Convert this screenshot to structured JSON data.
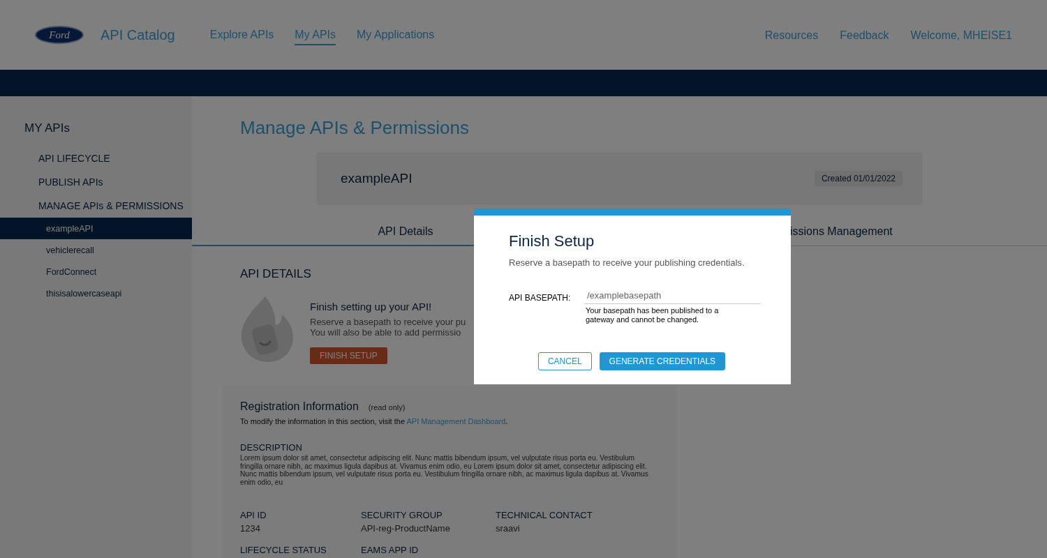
{
  "header": {
    "logo_text": "Ford",
    "app_title": "API Catalog",
    "nav": [
      {
        "label": "Explore APIs",
        "selected": false
      },
      {
        "label": "My APIs",
        "selected": true
      },
      {
        "label": "My Applications",
        "selected": false
      }
    ],
    "right_links": [
      "Resources",
      "Feedback",
      "Welcome, MHEISE1"
    ]
  },
  "sidebar": {
    "title": "MY APIs",
    "items": [
      {
        "label": "API LIFECYCLE",
        "selected": false
      },
      {
        "label": "PUBLISH APIs",
        "selected": false
      },
      {
        "label": "MANAGE APIs & PERMISSIONS",
        "selected": false,
        "children": [
          {
            "label": "exampleAPI",
            "selected": true
          },
          {
            "label": "vehiclerecall",
            "selected": false
          },
          {
            "label": "FordConnect",
            "selected": false
          },
          {
            "label": "thisisalowercaseapi",
            "selected": false
          }
        ]
      }
    ]
  },
  "page_title": "Manage APIs & Permissions",
  "api_card": {
    "name": "exampleAPI",
    "created": "Created 01/01/2022"
  },
  "tabs": [
    {
      "label": "API Details",
      "selected": true
    },
    {
      "label": "issions Management",
      "selected": false
    }
  ],
  "details": {
    "heading": "API DETAILS",
    "setup": {
      "title": "Finish setting up your API!",
      "lines": [
        "Reserve a basepath to receive your pu",
        "You will also be able to add permissio"
      ],
      "button": "FINISH SETUP"
    },
    "registration": {
      "title": "Registration Information",
      "note": "(read only)",
      "hint": "To modify the information in this section, visit the ",
      "link": "API Management Dashboard",
      "hint_end": ".",
      "description_label": "DESCRIPTION",
      "description": "Lorem ipsum dolor sit amet, consectetur adipiscing elit. Nunc mattis bibendum ipsum, vel vulputate risus porta eu. Vestibulum fringilla ornare nibh, ac maximus ligula dapibus at. Vivamus enim odio, eu Lorem ipsum dolor sit amet, consectetur adipiscing elit. Nunc mattis bibendum ipsum, vel vulputate risus porta eu. Vestibulum fringilla ornare nibh, ac maximus ligula dapibus at. Vivamus enim odio, eu",
      "fields": [
        {
          "label": "API ID",
          "value": "1234"
        },
        {
          "label": "SECURITY GROUP",
          "value": "API-reg-ProductName"
        },
        {
          "label": "TECHNICAL CONTACT",
          "value": "sraavi"
        },
        {
          "label": "LIFECYCLE STATUS"
        },
        {
          "label": "EAMS APP ID"
        }
      ]
    }
  },
  "modal": {
    "title": "Finish Setup",
    "subtitle": "Reserve a basepath to receive your publishing credentials.",
    "field_label": "API BASEPATH:",
    "field_value": "/examplebasepath",
    "helper": "Your basepath has been published to a gateway and cannot be changed.",
    "buttons": [
      {
        "kind": "secondary",
        "label": "CANCEL"
      },
      {
        "kind": "primary",
        "label": "GENERATE CREDENTIALS"
      }
    ]
  }
}
